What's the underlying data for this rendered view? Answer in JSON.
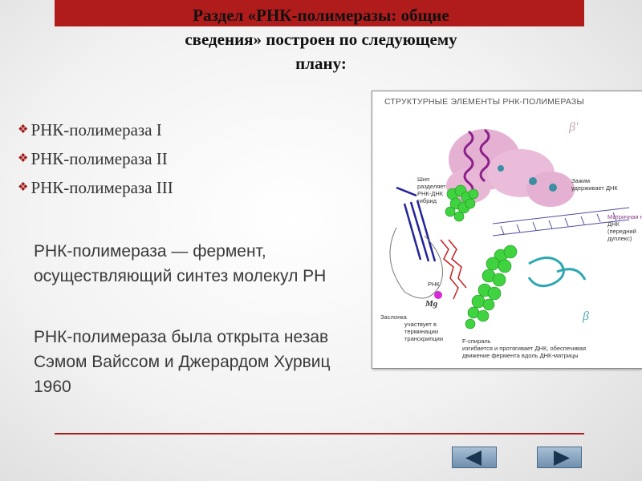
{
  "title": {
    "line1": "Раздел «РНК-полимеразы: общие",
    "line2": "сведения» построен по следующему",
    "line3": "плану:"
  },
  "bullets": [
    {
      "marker": "❖",
      "text": "РНК-полимераза I"
    },
    {
      "marker": "❖",
      "text": "РНК-полимераза II"
    },
    {
      "marker": "❖",
      "text": "РНК-полимераза III"
    }
  ],
  "paragraph1": {
    "line1": "РНК-полимераза — фермент,",
    "line2": "осуществляющий синтез молекул РН"
  },
  "paragraph2": {
    "line1": "РНК-полимераза была открыта незав",
    "line2": "Сэмом Вайссом и Джерардом Хурвиц",
    "line3": "1960"
  },
  "figure": {
    "title": "СТРУКТУРНЫЕ ЭЛЕМЕНТЫ РНК-ПОЛИМЕРАЗЫ",
    "beta_prime": "β'",
    "beta": "β",
    "mg": "Mg",
    "rna": "РНК",
    "ship": {
      "name": "Шип",
      "l1": "разделяет",
      "l2": "РНК-ДНК",
      "l3": "гибрид"
    },
    "zazhim": {
      "name": "Зажим",
      "desc": "удерживает ДНК"
    },
    "matrix": {
      "l1": "Матричная ни",
      "l2": "ДНК",
      "l3": "(передний",
      "l4": "дуплекс)"
    },
    "zaslonka": {
      "name": "Заслонка",
      "l1": "участвует в",
      "l2": "терминации",
      "l3": "транскрипции"
    },
    "fspiral": {
      "name": "F-спираль",
      "l1": "изгибается и протягивает ДНК, обеспечивая",
      "l2": "движение фермента вдоль ДНК-матрицы"
    },
    "colors": {
      "pink": "#e3a9cf",
      "purple": "#8a1f8a",
      "green": "#3fd43f",
      "blue": "#23239a",
      "teal": "#2fa7b0",
      "red": "#c62020",
      "magenta": "#d52ad5"
    }
  },
  "nav": {
    "prev_icon": "arrow-left-icon",
    "next_icon": "arrow-right-icon"
  },
  "colors": {
    "accent": "#b01c1c",
    "nav": "#7e9cba"
  }
}
